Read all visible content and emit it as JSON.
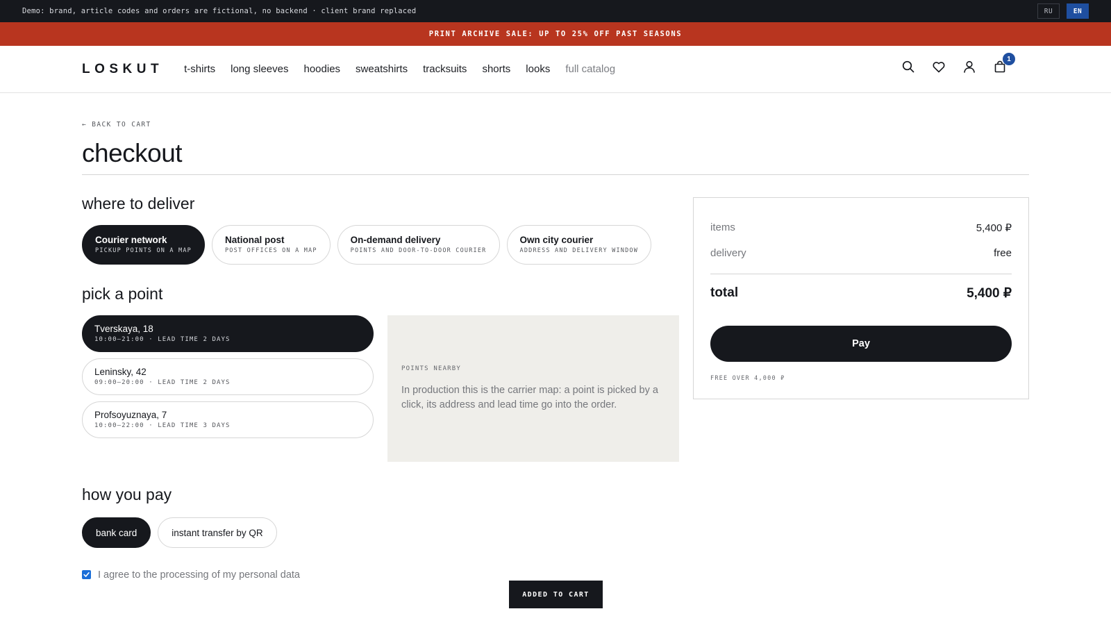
{
  "demo_bar": {
    "text": "Demo: brand, article codes and orders are fictional, no backend · client brand replaced",
    "languages": [
      {
        "label": "RU",
        "active": false
      },
      {
        "label": "EN",
        "active": true
      }
    ]
  },
  "sale_bar": {
    "text": "PRINT ARCHIVE SALE: UP TO 25% OFF PAST SEASONS"
  },
  "header": {
    "logo": "LOSKUT",
    "nav": [
      {
        "label": "t-shirts"
      },
      {
        "label": "long sleeves"
      },
      {
        "label": "hoodies"
      },
      {
        "label": "sweatshirts"
      },
      {
        "label": "tracksuits"
      },
      {
        "label": "shorts"
      },
      {
        "label": "looks"
      },
      {
        "label": "full catalog"
      }
    ],
    "icons": [
      "search-icon",
      "heart-icon",
      "user-icon",
      "bag-icon"
    ],
    "cart_count": "1",
    "accent": "#1f4fa0"
  },
  "checkout": {
    "back_link": "← BACK TO CART",
    "title": "checkout",
    "deliver_title": "where to deliver",
    "delivery_options": [
      {
        "title": "Courier network",
        "sub": "PICKUP POINTS ON A MAP",
        "selected": true
      },
      {
        "title": "National post",
        "sub": "POST OFFICES ON A MAP",
        "selected": false
      },
      {
        "title": "On-demand delivery",
        "sub": "POINTS AND DOOR-TO-DOOR COURIER",
        "selected": false
      },
      {
        "title": "Own city courier",
        "sub": "ADDRESS AND DELIVERY WINDOW",
        "selected": false
      }
    ],
    "point_title": "pick a point",
    "points": [
      {
        "name": "Tverskaya, 18",
        "meta": "10:00–21:00 · LEAD TIME 2 DAYS",
        "selected": true
      },
      {
        "name": "Leninsky, 42",
        "meta": "09:00–20:00 · LEAD TIME 2 DAYS",
        "selected": false
      },
      {
        "name": "Profsoyuznaya, 7",
        "meta": "10:00–22:00 · LEAD TIME 3 DAYS",
        "selected": false
      }
    ],
    "map": {
      "label": "POINTS NEARBY",
      "text": "In production this is the carrier map: a point is picked by a click, its address and lead time go into the order."
    },
    "pay_title": "how you pay",
    "pay_options": [
      {
        "label": "bank card",
        "selected": true
      },
      {
        "label": "instant transfer by QR",
        "selected": false
      }
    ],
    "consent": {
      "text": "I agree to the processing of my personal data",
      "checked": true
    }
  },
  "summary": {
    "items_label": "items",
    "items_value": "5,400 ₽",
    "delivery_label": "delivery",
    "delivery_value": "free",
    "total_label": "total",
    "total_value": "5,400 ₽",
    "pay_button": "Pay",
    "free_note": "FREE OVER 4,000 ₽"
  },
  "toast": {
    "text": "ADDED TO CART"
  }
}
